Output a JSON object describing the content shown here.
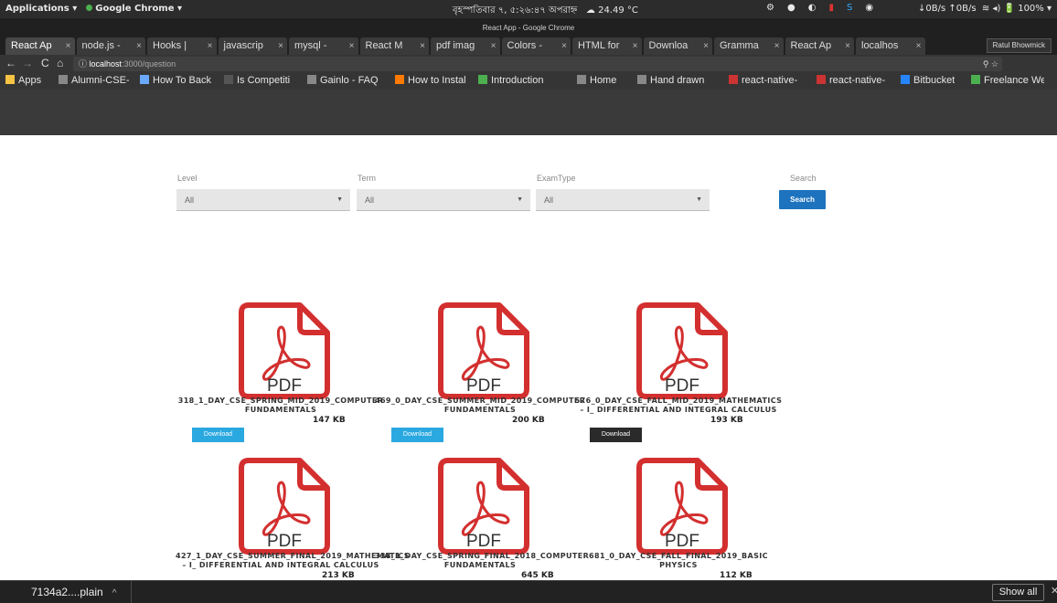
{
  "system": {
    "applications": "Applications ▾",
    "app_name": "Google Chrome ▾",
    "clock": "বৃহস্পতিবার ৭, ৫:২৬:৪৭ অপরাহ্ন",
    "weather": "☁ 24.49 °C",
    "net": "↓0B/s ↑0B/s",
    "battery": "🔋 100% ▾"
  },
  "window": {
    "title": "React App - Google Chrome",
    "profile": "Ratul Bhowmick"
  },
  "tabs": [
    {
      "label": "React Ap",
      "active": true
    },
    {
      "label": "node.js -"
    },
    {
      "label": "Hooks |"
    },
    {
      "label": "javascrip"
    },
    {
      "label": "mysql -"
    },
    {
      "label": "React M"
    },
    {
      "label": "pdf imag"
    },
    {
      "label": "Colors -"
    },
    {
      "label": "HTML for"
    },
    {
      "label": "Downloa"
    },
    {
      "label": "Gramma"
    },
    {
      "label": "React Ap"
    },
    {
      "label": "localhos"
    }
  ],
  "address": {
    "host": "localhost",
    "path": ":3000/question"
  },
  "bookmarks": [
    {
      "label": "Apps"
    },
    {
      "label": "Alumni-CSE-"
    },
    {
      "label": "How To Back"
    },
    {
      "label": "Is Competiti"
    },
    {
      "label": "Gainlo - FAQ"
    },
    {
      "label": "How to Instal"
    },
    {
      "label": "Introduction"
    },
    {
      "label": "Home"
    },
    {
      "label": "Hand drawn"
    },
    {
      "label": "react-native-"
    },
    {
      "label": "react-native-"
    },
    {
      "label": "Bitbucket"
    },
    {
      "label": "Freelance We"
    }
  ],
  "filters": {
    "level_label": "Level",
    "level_value": "All",
    "term_label": "Term",
    "term_value": "All",
    "examtype_label": "ExamType",
    "examtype_value": "All",
    "search_label": "Search",
    "search_button": "Search"
  },
  "files": [
    {
      "icon_text": "PDF",
      "name": "318_1_DAY_CSE_SPRING_MID_2019_COMPUTER FUNDAMENTALS",
      "size": "147 KB",
      "download": "Download",
      "button_color": "#2aa8e0"
    },
    {
      "icon_text": "PDF",
      "name": "469_0_DAY_CSE_SUMMER_MID_2019_COMPUTER FUNDAMENTALS",
      "size": "200 KB",
      "download": "Download",
      "button_color": "#2aa8e0"
    },
    {
      "icon_text": "PDF",
      "name": "576_0_DAY_CSE_FALL_MID_2019_MATHEMATICS – I_ DIFFERENTIAL AND INTEGRAL CALCULUS",
      "size": "193 KB",
      "download": "Download",
      "button_color": "#2a2a2a"
    },
    {
      "icon_text": "PDF",
      "name": "427_1_DAY_CSE_SUMMER_FINAL_2019_MATHEMATICS – I_ DIFFERENTIAL AND INTEGRAL CALCULUS",
      "size": "213 KB"
    },
    {
      "icon_text": "PDF",
      "name": "338_1_DAY_CSE_SPRING_FINAL_2018_COMPUTER FUNDAMENTALS",
      "size": "645 KB"
    },
    {
      "icon_text": "PDF",
      "name": "681_0_DAY_CSE_FALL_FINAL_2019_BASIC PHYSICS",
      "size": "112 KB"
    }
  ],
  "download_bar": {
    "item": "7134a2....plain",
    "show_all": "Show all"
  },
  "colors": {
    "pdf_red": "#d32f2f",
    "primary_blue": "#1e73be",
    "download_blue": "#2aa8e0"
  }
}
